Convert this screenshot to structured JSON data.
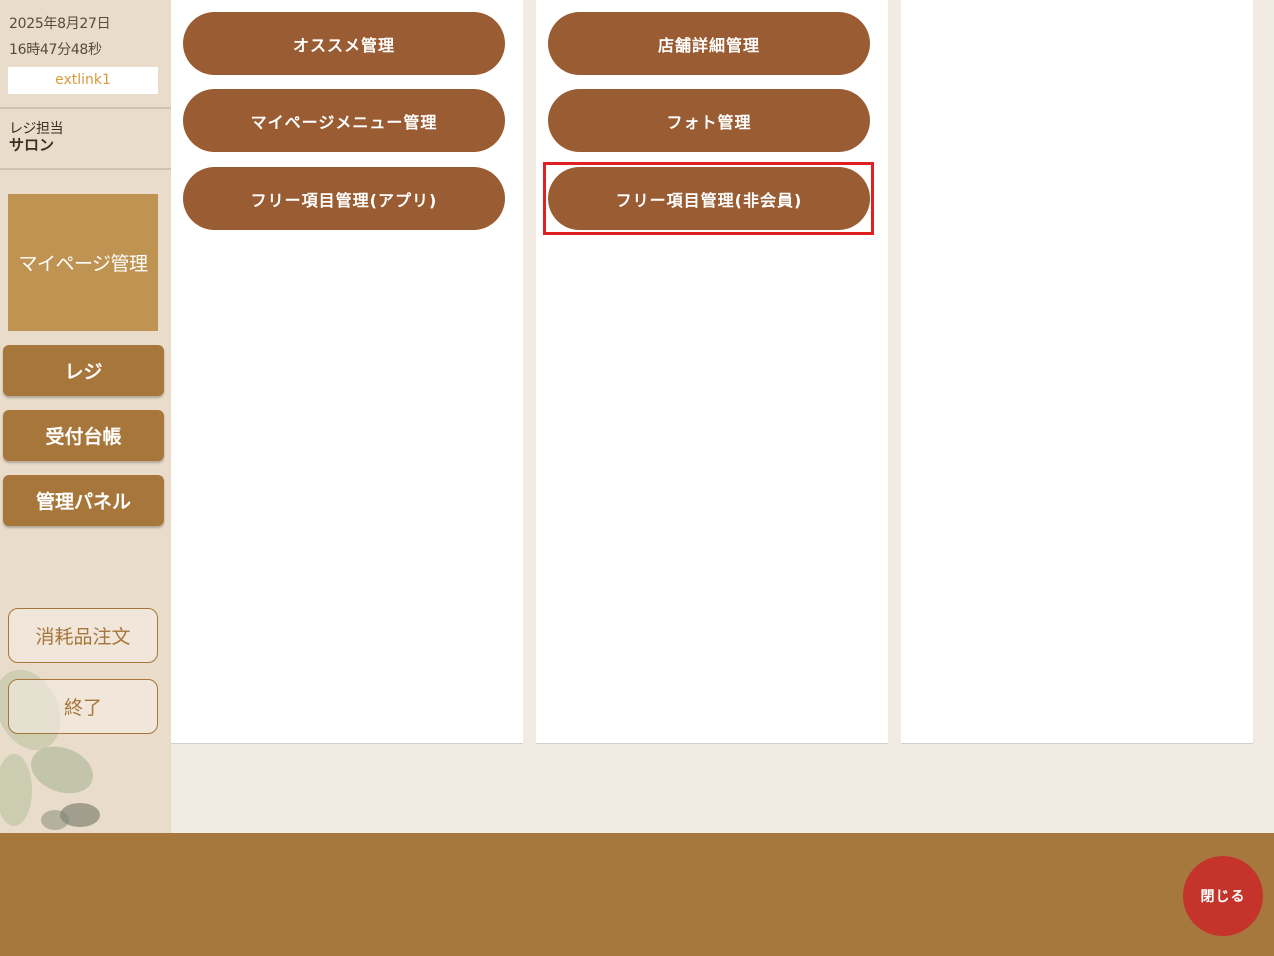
{
  "sidebar": {
    "date": "2025年8月27日",
    "time": "16時47分48秒",
    "link": "extlink1",
    "staff_label": "レジ担当",
    "staff_name": "サロン",
    "mypage": "マイページ管理",
    "nav": [
      "レジ",
      "受付台帳",
      "管理パネル"
    ],
    "consumables": "消耗品注文",
    "exit": "終了"
  },
  "columns": [
    {
      "buttons": [
        "オススメ管理",
        "マイページメニュー管理",
        "フリー項目管理(アプリ)"
      ]
    },
    {
      "buttons": [
        "店舗詳細管理",
        "フォト管理",
        "フリー項目管理(非会員)"
      ]
    },
    {
      "buttons": []
    }
  ],
  "footer": {
    "close": "閉じる"
  },
  "colors": {
    "accent": "#9a5c32",
    "highlight": "#e02020",
    "footer": "#a6783d",
    "close": "#c4342a"
  }
}
